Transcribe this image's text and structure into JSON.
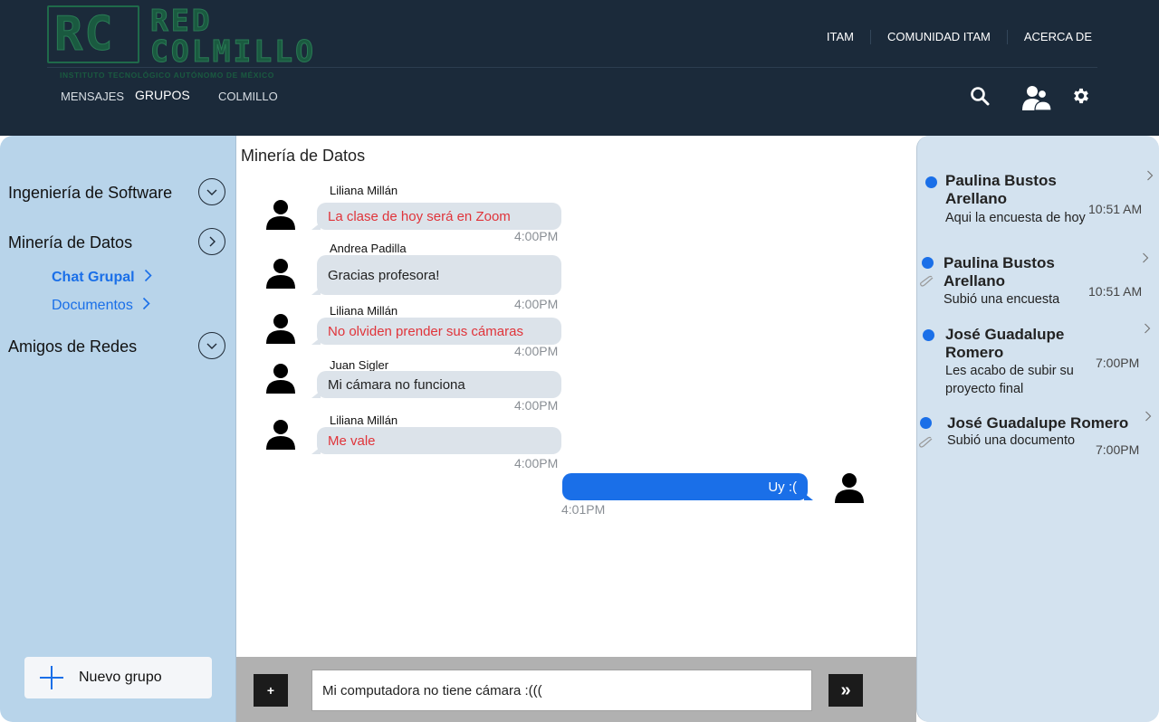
{
  "brand": {
    "logo_initials": "RC",
    "logo_name_line1": "RED",
    "logo_name_line2": "COLMILLO",
    "logo_subtitle": "INSTITUTO TECNOLÓGICO AUTÓNOMO DE MÉXICO"
  },
  "top_links": [
    "ITAM",
    "COMUNIDAD ITAM",
    "ACERCA DE"
  ],
  "nav": {
    "items": [
      {
        "label": "MENSAJES",
        "active": false
      },
      {
        "label": "GRUPOS",
        "active": true
      },
      {
        "label": "COLMILLO",
        "active": false
      }
    ]
  },
  "header_icons": [
    "search-icon",
    "contacts-icon",
    "gear-icon"
  ],
  "sidebar": {
    "groups": [
      {
        "label": "Ingeniería de Software",
        "expanded": false
      },
      {
        "label": "Minería de Datos",
        "expanded": true
      },
      {
        "label": "Amigos de Redes",
        "expanded": false
      }
    ],
    "subitems": [
      {
        "label": "Chat Grupal",
        "active": true
      },
      {
        "label": "Documentos",
        "active": false
      }
    ],
    "new_group_label": "Nuevo grupo"
  },
  "chat": {
    "title": "Minería de Datos",
    "messages": [
      {
        "sender": "Liliana Millán",
        "text": "La clase de hoy será en Zoom",
        "time": "4:00PM",
        "highlight": true
      },
      {
        "sender": "Andrea Padilla",
        "text": "Gracias profesora!",
        "time": "4:00PM",
        "highlight": false
      },
      {
        "sender": "Liliana Millán",
        "text": "No olviden prender sus cámaras",
        "time": "4:00PM",
        "highlight": true
      },
      {
        "sender": "Juan Sigler",
        "text": "Mi cámara no funciona",
        "time": "4:00PM",
        "highlight": false
      },
      {
        "sender": "Liliana Millán",
        "text": "Me vale",
        "time": "4:00PM",
        "highlight": true
      }
    ],
    "my_message": {
      "text": "Uy :(",
      "time": "4:01PM"
    },
    "composer": {
      "plus_label": "+",
      "input_value": "Mi computadora no tiene cámara :(((",
      "send_label": "»"
    }
  },
  "notifications": [
    {
      "name": "Paulina Bustos Arellano",
      "text": "Aqui la encuesta de hoy",
      "time": "10:51 AM",
      "attachment": false
    },
    {
      "name": "Paulina Bustos Arellano",
      "text": "Subió una encuesta",
      "time": "10:51 AM",
      "attachment": true
    },
    {
      "name": "José Guadalupe Romero",
      "text": "Les acabo de subir su proyecto final",
      "time": "7:00PM",
      "attachment": false
    },
    {
      "name": "José Guadalupe Romero",
      "text": "Subió una documento",
      "time": "7:00PM",
      "attachment": true
    }
  ],
  "colors": {
    "header_bg": "#1b2a3a",
    "accent": "#1a6fe8",
    "sidebar_bg": "#b8d4ea",
    "right_panel_bg": "#d3e2ef",
    "bubble_bg": "#dce3ea",
    "highlight_text": "#e0343a",
    "logo_green": "#1a5a40"
  }
}
